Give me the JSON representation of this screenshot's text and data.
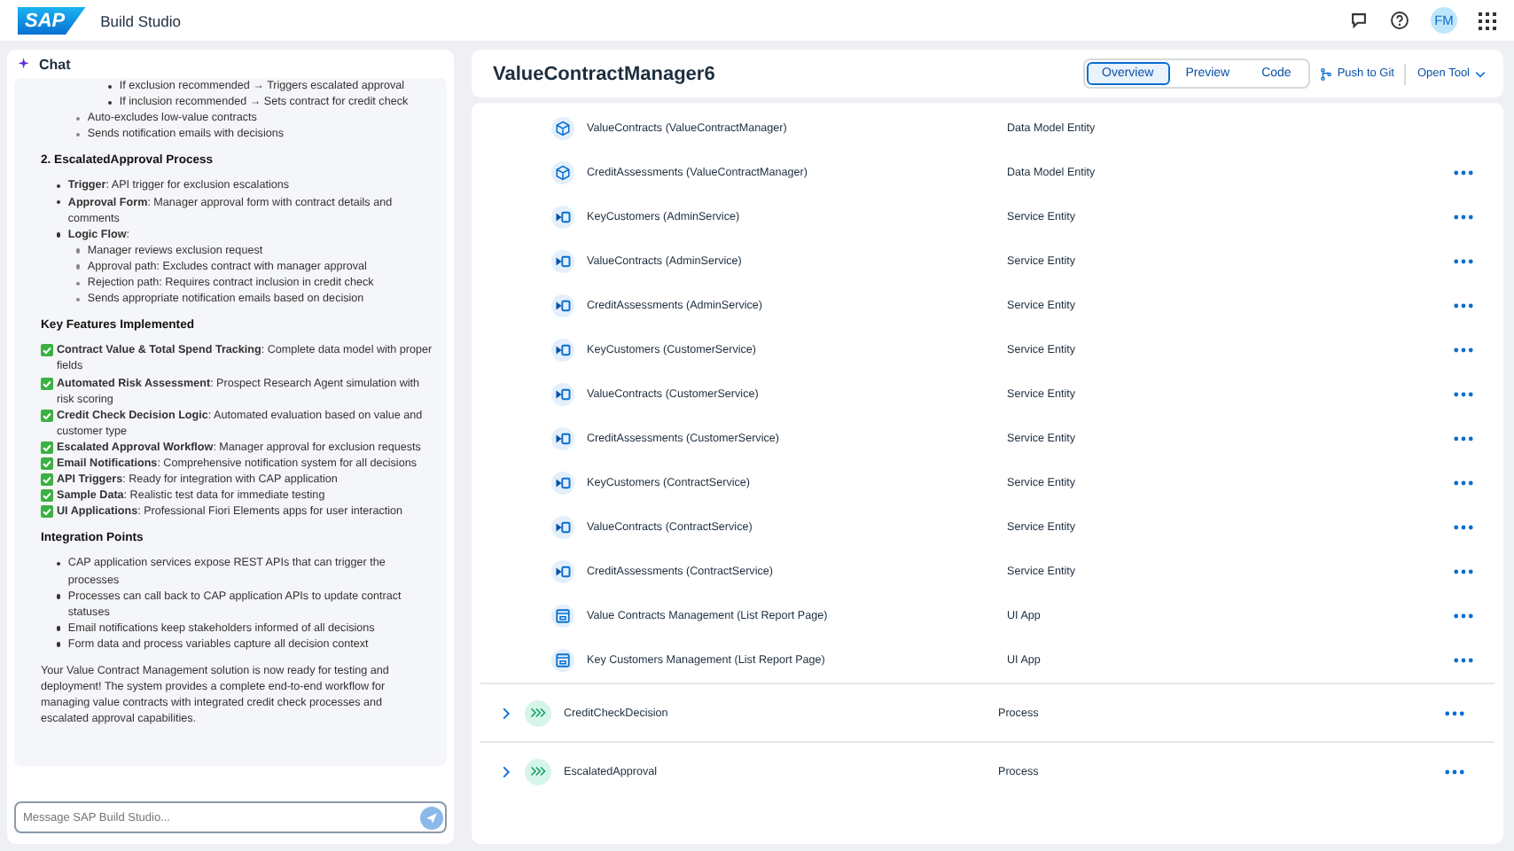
{
  "top_bar": {
    "logo": "SAP",
    "product": "Build Studio",
    "avatar": "FM"
  },
  "chat": {
    "title": "Chat",
    "blocks": [
      {
        "kind": "list",
        "items": [
          {
            "children": [
              {
                "children": [
                  {
                    "text": "If exclusion recommended → Triggers escalated approval"
                  },
                  {
                    "text": "If inclusion recommended → Sets contract for credit check"
                  }
                ]
              },
              {
                "text": "Auto-excludes low-value contracts"
              },
              {
                "text": "Sends notification emails with decisions"
              }
            ]
          }
        ]
      },
      {
        "kind": "heading",
        "text": "2. EscalatedApproval Process"
      },
      {
        "kind": "list",
        "items": [
          {
            "text": "**Trigger**: API trigger for exclusion escalations"
          },
          {
            "text": "**Approval Form**: Manager approval form with contract details and comments"
          },
          {
            "text": "**Logic Flow**:",
            "children": [
              {
                "text": "Manager reviews exclusion request"
              },
              {
                "text": "Approval path: Excludes contract with manager approval"
              },
              {
                "text": "Rejection path: Requires contract inclusion in credit check"
              },
              {
                "text": "Sends appropriate notification emails based on decision"
              }
            ]
          }
        ]
      },
      {
        "kind": "heading",
        "text": "Key Features Implemented"
      },
      {
        "kind": "features",
        "items": [
          {
            "text": "**Contract Value & Total Spend Tracking**: Complete data model with proper fields"
          },
          {
            "text": "**Automated Risk Assessment**: Prospect Research Agent simulation with risk scoring"
          },
          {
            "text": "**Credit Check Decision Logic**: Automated evaluation based on value and customer type"
          },
          {
            "text": "**Escalated Approval Workflow**: Manager approval for exclusion requests"
          },
          {
            "text": "**Email Notifications**: Comprehensive notification system for all decisions"
          },
          {
            "text": "**API Triggers**: Ready for integration with CAP application"
          },
          {
            "text": "**Sample Data**: Realistic test data for immediate testing"
          },
          {
            "text": "**UI Applications**: Professional Fiori Elements apps for user interaction"
          }
        ]
      },
      {
        "kind": "heading",
        "text": "Integration Points"
      },
      {
        "kind": "list",
        "items": [
          {
            "text": "CAP application services expose REST APIs that can trigger the processes"
          },
          {
            "text": "Processes can call back to CAP application APIs to update contract statuses"
          },
          {
            "text": "Email notifications keep stakeholders informed of all decisions"
          },
          {
            "text": "Form data and process variables capture all decision context"
          }
        ]
      },
      {
        "kind": "paragraph",
        "text": "Your Value Contract Management solution is now ready for testing and deployment! The system provides a complete end-to-end workflow for managing value contracts with integrated credit check processes and escalated approval capabilities."
      }
    ],
    "input": {
      "placeholder": "Message SAP Build Studio..."
    }
  },
  "project": {
    "title": "ValueContractManager6",
    "tabs": [
      {
        "label": "Overview",
        "selected": true
      },
      {
        "label": "Preview",
        "selected": false
      },
      {
        "label": "Code",
        "selected": false
      }
    ],
    "push_button": "Push to Git",
    "open_tool": "Open Tool",
    "entities": [
      {
        "kind": "data_model",
        "name": "ValueContracts (ValueContractManager)",
        "type": "Data Model Entity",
        "has_menu": false
      },
      {
        "kind": "data_model",
        "name": "CreditAssessments (ValueContractManager)",
        "type": "Data Model Entity",
        "has_menu": true
      },
      {
        "kind": "service",
        "name": "KeyCustomers (AdminService)",
        "type": "Service Entity",
        "has_menu": true
      },
      {
        "kind": "service",
        "name": "ValueContracts (AdminService)",
        "type": "Service Entity",
        "has_menu": true
      },
      {
        "kind": "service",
        "name": "CreditAssessments (AdminService)",
        "type": "Service Entity",
        "has_menu": true
      },
      {
        "kind": "service",
        "name": "KeyCustomers (CustomerService)",
        "type": "Service Entity",
        "has_menu": true
      },
      {
        "kind": "service",
        "name": "ValueContracts (CustomerService)",
        "type": "Service Entity",
        "has_menu": true
      },
      {
        "kind": "service",
        "name": "CreditAssessments (CustomerService)",
        "type": "Service Entity",
        "has_menu": true
      },
      {
        "kind": "service",
        "name": "KeyCustomers (ContractService)",
        "type": "Service Entity",
        "has_menu": true
      },
      {
        "kind": "service",
        "name": "ValueContracts (ContractService)",
        "type": "Service Entity",
        "has_menu": true
      },
      {
        "kind": "service",
        "name": "CreditAssessments (ContractService)",
        "type": "Service Entity",
        "has_menu": true
      },
      {
        "kind": "ui_app",
        "name": "Value Contracts Management (List Report Page)",
        "type": "UI App",
        "has_menu": true
      },
      {
        "kind": "ui_app",
        "name": "Key Customers Management (List Report Page)",
        "type": "UI App",
        "has_menu": true
      }
    ],
    "processes": [
      {
        "name": "CreditCheckDecision",
        "type": "Process",
        "expanded": false
      },
      {
        "name": "EscalatedApproval",
        "type": "Process",
        "expanded": false
      }
    ]
  }
}
